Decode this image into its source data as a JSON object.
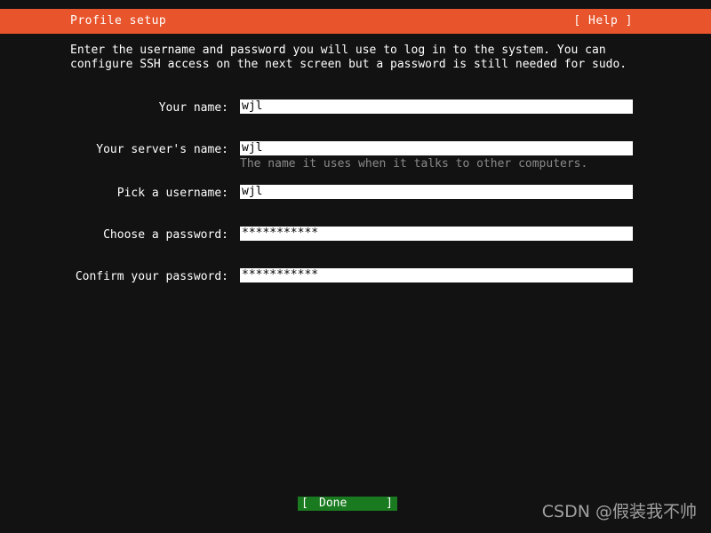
{
  "header": {
    "title": "Profile setup",
    "help_label": "[ Help ]",
    "bg_color": "#e8542b",
    "fg_color": "#ffffff"
  },
  "intro": {
    "text": "Enter the username and password you will use to log in to the system. You can configure SSH access on the next screen but a password is still needed for sudo."
  },
  "form": {
    "fields": [
      {
        "label": "Your name:",
        "value": "wjl",
        "hint": ""
      },
      {
        "label": "Your server's name:",
        "value": "wjl",
        "hint": "The name it uses when it talks to other computers."
      },
      {
        "label": "Pick a username:",
        "value": "wjl",
        "hint": ""
      },
      {
        "label": "Choose a password:",
        "value": "***********",
        "hint": ""
      },
      {
        "label": "Confirm your password:",
        "value": "***********",
        "hint": ""
      }
    ]
  },
  "footer": {
    "done_open_bracket": "[",
    "done_label": "Done",
    "done_close_bracket": "]",
    "done_bg_color": "#1a7a20"
  },
  "watermark": {
    "text": "CSDN @假装我不帅"
  },
  "terminal": {
    "bg_color": "#121212",
    "fg_color": "#ffffff",
    "hint_color": "#8a8a8a"
  }
}
